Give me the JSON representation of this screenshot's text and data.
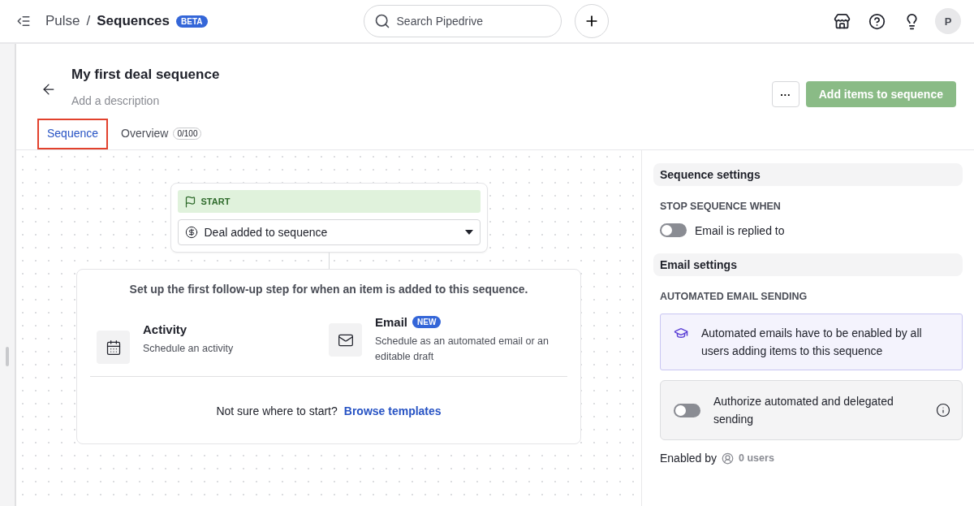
{
  "topbar": {
    "breadcrumb_parent": "Pulse",
    "breadcrumb_separator": "/",
    "title": "Sequences",
    "badge": "BETA",
    "search": {
      "placeholder": "Search Pipedrive"
    },
    "avatar": "P"
  },
  "header": {
    "title": "My first deal sequence",
    "description_placeholder": "Add a description",
    "more_button": "···",
    "primary_button": "Add items to sequence"
  },
  "tabs": [
    {
      "label": "Sequence",
      "selected": true
    },
    {
      "label": "Overview",
      "count": "0/100",
      "selected": false
    }
  ],
  "canvas": {
    "start": {
      "label": "START",
      "trigger": "Deal added to sequence"
    },
    "step_card": {
      "prompt": "Set up the first follow-up step for when an item is added to this sequence.",
      "options": [
        {
          "kind": "activity",
          "title": "Activity",
          "description": "Schedule an activity"
        },
        {
          "kind": "email",
          "title": "Email",
          "badge": "NEW",
          "description": "Schedule as an automated email or an editable draft"
        }
      ],
      "help_text": "Not sure where to start?",
      "help_link": "Browse templates"
    }
  },
  "settings": {
    "sequence_title": "Sequence settings",
    "stop_label": "STOP SEQUENCE WHEN",
    "stop_toggle": {
      "label": "Email is replied to",
      "on": false
    },
    "email_title": "Email settings",
    "auto_label": "AUTOMATED EMAIL SENDING",
    "notice": "Automated emails have to be enabled by all users adding items to this sequence",
    "auth_toggle": {
      "label": "Authorize automated and delegated sending",
      "on": false
    },
    "enabled_by_label": "Enabled by",
    "enabled_by_value": "0 users"
  }
}
